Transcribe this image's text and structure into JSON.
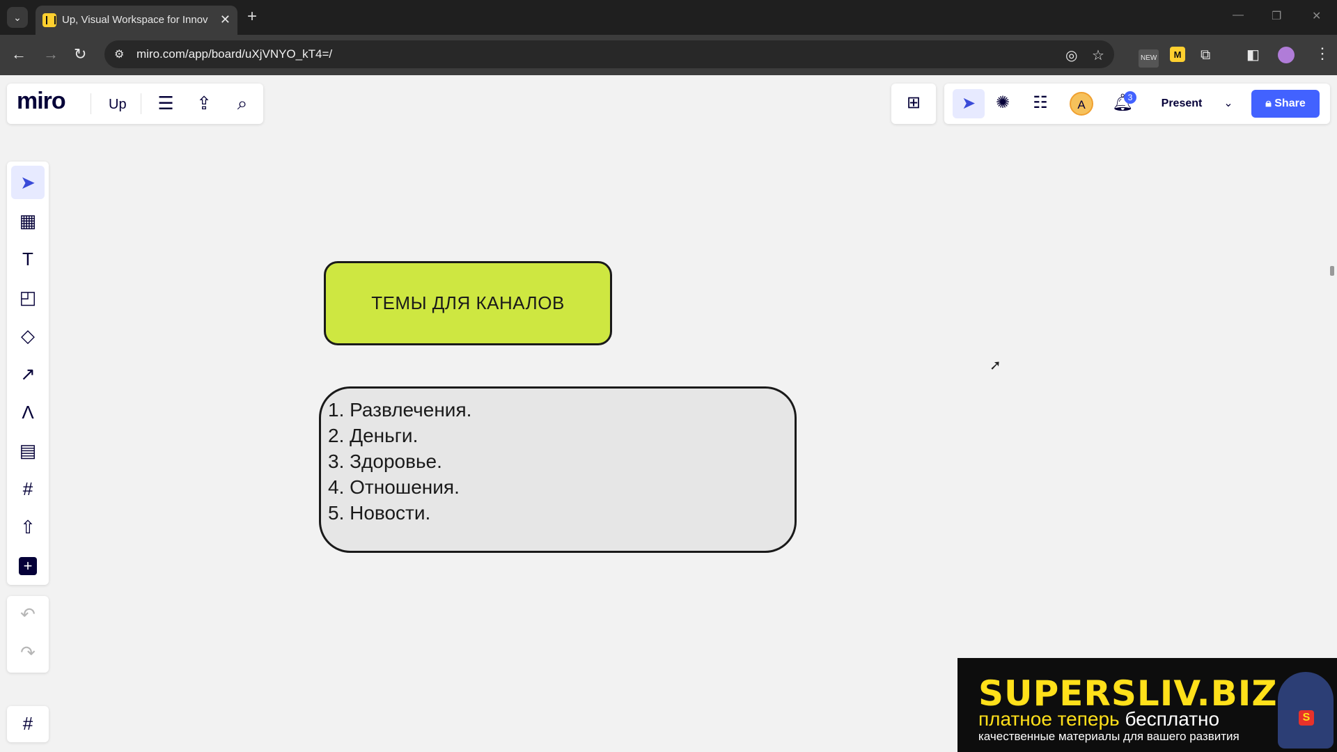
{
  "browser": {
    "tab_title": "Up, Visual Workspace for Innov",
    "url": "miro.com/app/board/uXjVNYO_kT4=/",
    "ext_new_label": "NEW"
  },
  "miro": {
    "logo": "miro",
    "board_name": "Up",
    "avatar_initial": "A",
    "notification_count": "3",
    "present_label": "Present",
    "share_label": "Share",
    "colors": {
      "accent": "#4262ff",
      "active_bg": "#e7eaff",
      "title_fill": "#cee741",
      "list_fill": "#e6e6e6"
    }
  },
  "canvas": {
    "title_shape": "ТЕМЫ ДЛЯ КАНАЛОВ",
    "list_items": [
      "1. Развлечения.",
      "2. Деньги.",
      "3. Здоровье.",
      "4. Отношения.",
      "5. Новости."
    ]
  },
  "ad": {
    "brand": "SUPERSLIV.BIZ",
    "tagline_1": "платное теперь",
    "tagline_2": "бесплатно",
    "subtitle": "качественные материалы для вашего развития"
  }
}
